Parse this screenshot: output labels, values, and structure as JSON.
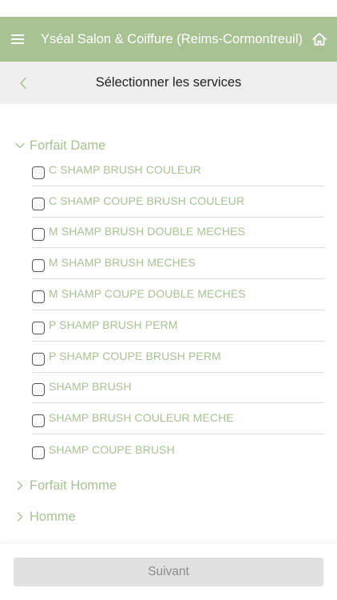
{
  "header": {
    "title": "Yséal Salon & Coiffure (Reims-Cormontreuil)",
    "menu_icon": "hamburger-menu-icon",
    "home_icon": "home-icon"
  },
  "subheader": {
    "title": "Sélectionner les services",
    "back_icon": "chevron-left-icon"
  },
  "categories": [
    {
      "label": "Forfait Dame",
      "expanded": true,
      "services": [
        "C SHAMP BRUSH COULEUR",
        "C SHAMP COUPE BRUSH COULEUR",
        "M SHAMP BRUSH DOUBLE MECHES",
        "M SHAMP BRUSH MECHES",
        "M SHAMP COUPE DOUBLE MECHES",
        "P SHAMP BRUSH PERM",
        "P SHAMP COUPE BRUSH PERM",
        "SHAMP BRUSH",
        "SHAMP BRUSH COULEUR MECHE",
        "SHAMP COUPE BRUSH"
      ]
    },
    {
      "label": "Forfait Homme",
      "expanded": false
    },
    {
      "label": "Homme",
      "expanded": false
    }
  ],
  "footer": {
    "next_label": "Suivant"
  },
  "colors": {
    "brand_green": "#a9c294",
    "subheader_bg": "#efefef",
    "button_disabled_bg": "#e1e1e1"
  }
}
